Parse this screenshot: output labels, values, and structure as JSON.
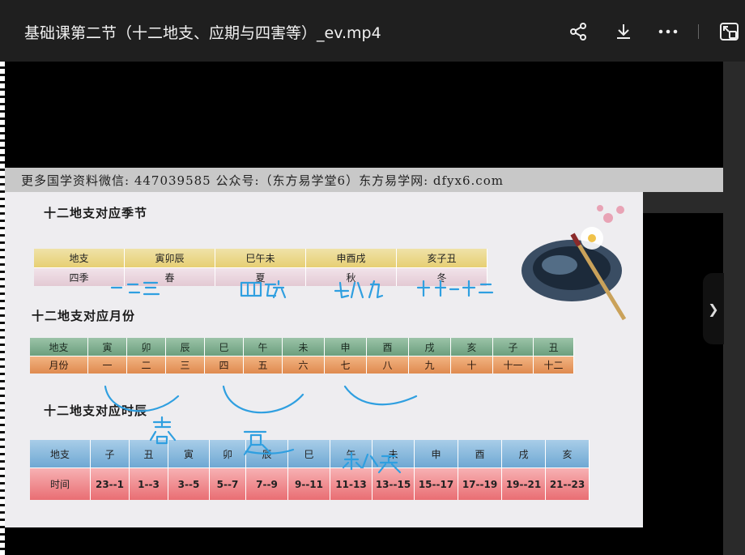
{
  "header": {
    "title": "基础课第二节（十二地支、应期与四害等）_ev.mp4",
    "icons": [
      "share-icon",
      "download-icon",
      "more-icon",
      "pip-icon"
    ]
  },
  "slide": {
    "banner": "更多国学资料微信: 447039585 公众号:（东方易学堂6）东方易学网: dfyx6.com",
    "season_heading": "十二地支对应季节",
    "month_heading": "十二地支对应月份",
    "hour_heading": "十二地支对应时辰",
    "season_table": {
      "label_row1": "地支",
      "label_row2": "四季",
      "branches": [
        "寅卯辰",
        "巳午未",
        "申酉戌",
        "亥子丑"
      ],
      "seasons": [
        "春",
        "夏",
        "秋",
        "冬"
      ]
    },
    "month_table": {
      "label_row1": "地支",
      "label_row2": "月份",
      "branches": [
        "寅",
        "卯",
        "辰",
        "巳",
        "午",
        "未",
        "申",
        "酉",
        "戌",
        "亥",
        "子",
        "丑"
      ],
      "months": [
        "一",
        "二",
        "三",
        "四",
        "五",
        "六",
        "七",
        "八",
        "九",
        "十",
        "十一",
        "十二"
      ]
    },
    "hour_table": {
      "label_row1": "地支",
      "label_row2": "时间",
      "branches": [
        "子",
        "丑",
        "寅",
        "卯",
        "辰",
        "巳",
        "午",
        "未",
        "申",
        "酉",
        "戌",
        "亥"
      ],
      "hours": [
        "23--1",
        "1--3",
        "3--5",
        "5--7",
        "7--9",
        "9--11",
        "11-13",
        "13--15",
        "15--17",
        "17--19",
        "19--21",
        "21--23"
      ]
    },
    "handwriting": {
      "notes": [
        "一二三",
        "四五六",
        "七八九",
        "十十一十二",
        "春",
        "夏",
        "秋天"
      ],
      "color": "#2f9fe0"
    }
  }
}
